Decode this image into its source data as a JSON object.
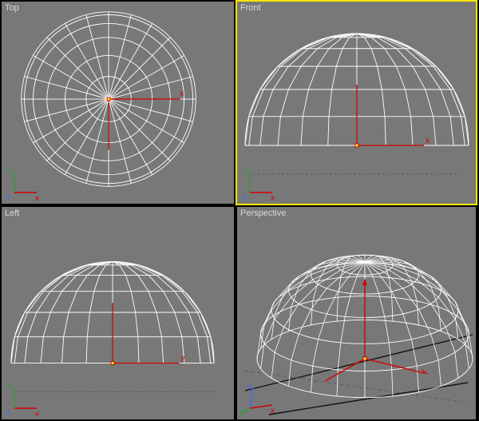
{
  "viewports": {
    "top_left": {
      "label": "Top",
      "active": false,
      "gizmo": {
        "axes": [
          "x",
          "y",
          "z"
        ],
        "up": "y",
        "right": "x"
      }
    },
    "top_right": {
      "label": "Front",
      "active": true,
      "gizmo": {
        "axes": [
          "x",
          "z",
          "y"
        ],
        "up": "z",
        "right": "x"
      }
    },
    "bottom_left": {
      "label": "Left",
      "active": false,
      "gizmo": {
        "axes": [
          "y",
          "z",
          "x"
        ],
        "up": "z",
        "right": "y"
      }
    },
    "bottom_right": {
      "label": "Perspective",
      "active": false,
      "gizmo": {
        "axes": [
          "x",
          "y",
          "z"
        ]
      }
    }
  },
  "object": {
    "type": "hemisphere",
    "segments": 24,
    "rings": 6,
    "wire_color": "#ffffff",
    "selected": true
  },
  "colors": {
    "bg": "#787878",
    "grid": "#5a5a5a",
    "wire": "#ffffff",
    "axis_x": "#d40000",
    "axis_y": "#00a000",
    "axis_z": "#d40000",
    "active_border": "#ffe600",
    "label": "#d8d8d8"
  },
  "scene_axes": {
    "x_label": "x",
    "y_label": "y",
    "z_label": "z"
  }
}
